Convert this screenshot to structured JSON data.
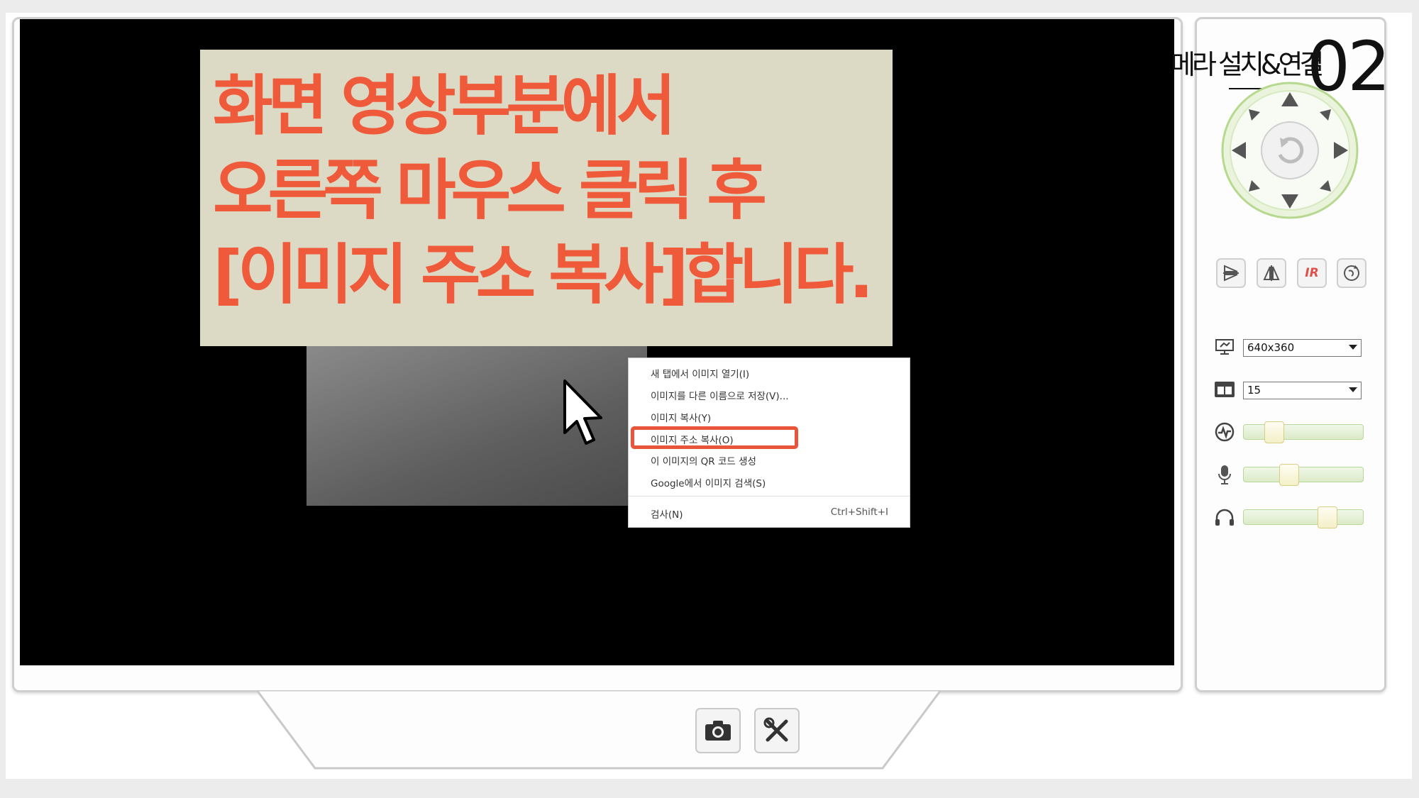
{
  "overlay": {
    "lines": [
      "화면 영상부분에서",
      "오른쪽 마우스 클릭 후",
      "[이미지 주소 복사]합니다."
    ],
    "background_color": "#dcd9c5",
    "text_color": "#ef5a3b"
  },
  "context_menu": {
    "items": [
      {
        "label": "새 탭에서 이미지 열기(I)"
      },
      {
        "label": "이미지를 다른 이름으로 저장(V)..."
      },
      {
        "label": "이미지 복사(Y)"
      },
      {
        "label": "이미지 주소 복사(O)",
        "highlighted": true
      },
      {
        "label": "이 이미지의 QR 코드 생성"
      },
      {
        "label": "Google에서 이미지 검색(S)"
      }
    ],
    "inspect": {
      "label": "검사(N)",
      "shortcut": "Ctrl+Shift+I"
    },
    "highlight_color": "#e8553a"
  },
  "side_panel": {
    "title": "메라 설치&연결",
    "number": "02",
    "ptz_icons": [
      "arrow-up-icon",
      "arrow-down-icon",
      "arrow-left-icon",
      "arrow-right-icon",
      "arrow-up-left-icon",
      "arrow-up-right-icon",
      "arrow-down-left-icon",
      "arrow-down-right-icon",
      "refresh-icon"
    ],
    "tool_buttons": [
      {
        "icon": "flip-icon"
      },
      {
        "icon": "mirror-icon"
      },
      {
        "icon": "ir-icon",
        "label": "IR",
        "color": "#e0504a"
      },
      {
        "icon": "rotate-icon"
      }
    ],
    "resolution": {
      "icon": "monitor-icon",
      "value": "640x360"
    },
    "framerate": {
      "icon": "film-icon",
      "value": "15"
    },
    "sliders": [
      {
        "icon": "activity-icon",
        "value": 0.22
      },
      {
        "icon": "microphone-icon",
        "value": 0.37
      },
      {
        "icon": "headphones-icon",
        "value": 0.7
      }
    ],
    "accent_color": "#8cc063"
  },
  "bottom_buttons": [
    {
      "icon": "camera-icon"
    },
    {
      "icon": "tools-icon"
    }
  ]
}
